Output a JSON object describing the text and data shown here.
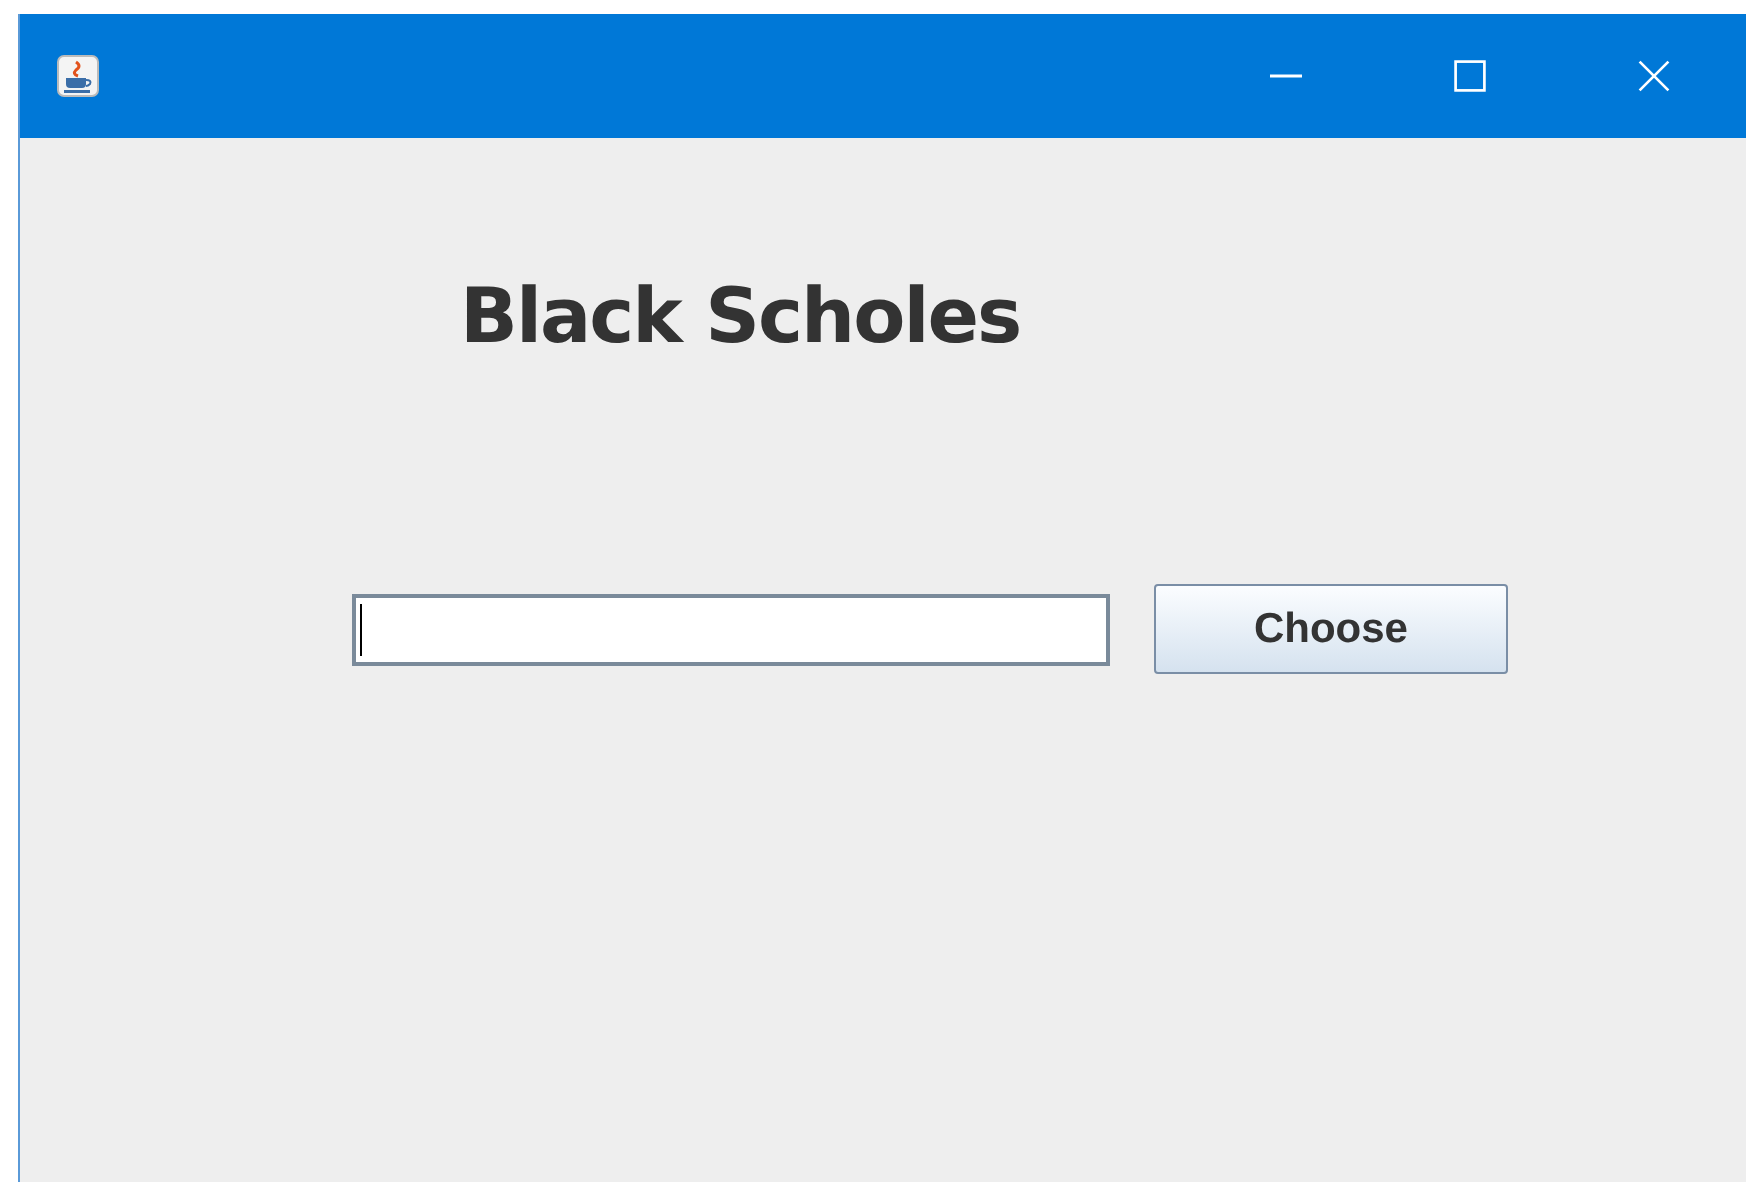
{
  "heading": "Black Scholes",
  "file_field": {
    "focused": true
  },
  "button": {
    "label": "Choose"
  }
}
